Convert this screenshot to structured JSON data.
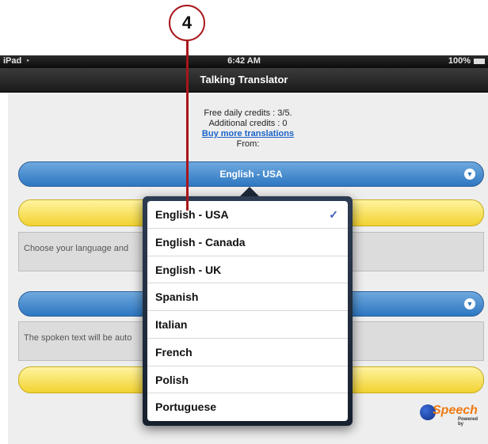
{
  "callout": {
    "number": "4"
  },
  "status_bar": {
    "carrier": "iPad",
    "time": "6:42 AM",
    "battery": "100%"
  },
  "header": {
    "title": "Talking Translator"
  },
  "credits": {
    "daily": "Free daily credits : 3/5.",
    "additional": "Additional credits : 0",
    "buy_link": "Buy more translations",
    "from_label": "From:"
  },
  "from_select": {
    "value": "English - USA"
  },
  "input_text": {
    "placeholder": "Choose your language and"
  },
  "output_text": {
    "placeholder": "The spoken text will be auto"
  },
  "language_popover": {
    "items": [
      {
        "label": "English - USA",
        "selected": true
      },
      {
        "label": "English - Canada",
        "selected": false
      },
      {
        "label": "English - UK",
        "selected": false
      },
      {
        "label": "Spanish",
        "selected": false
      },
      {
        "label": "Italian",
        "selected": false
      },
      {
        "label": "French",
        "selected": false
      },
      {
        "label": "Polish",
        "selected": false
      },
      {
        "label": "Portuguese",
        "selected": false
      }
    ],
    "checkmark": "✓"
  },
  "logo": {
    "brand": "Speech",
    "tagline": "Powered by"
  },
  "icons": {
    "wifi": "wifi-icon",
    "battery": "battery-icon",
    "chevron": "chevron-down-icon",
    "check": "checkmark-icon"
  },
  "colors": {
    "accent_blue": "#2d77c2",
    "accent_yellow": "#f2d230",
    "callout_red": "#a8151b",
    "link_blue": "#1a63c8"
  }
}
